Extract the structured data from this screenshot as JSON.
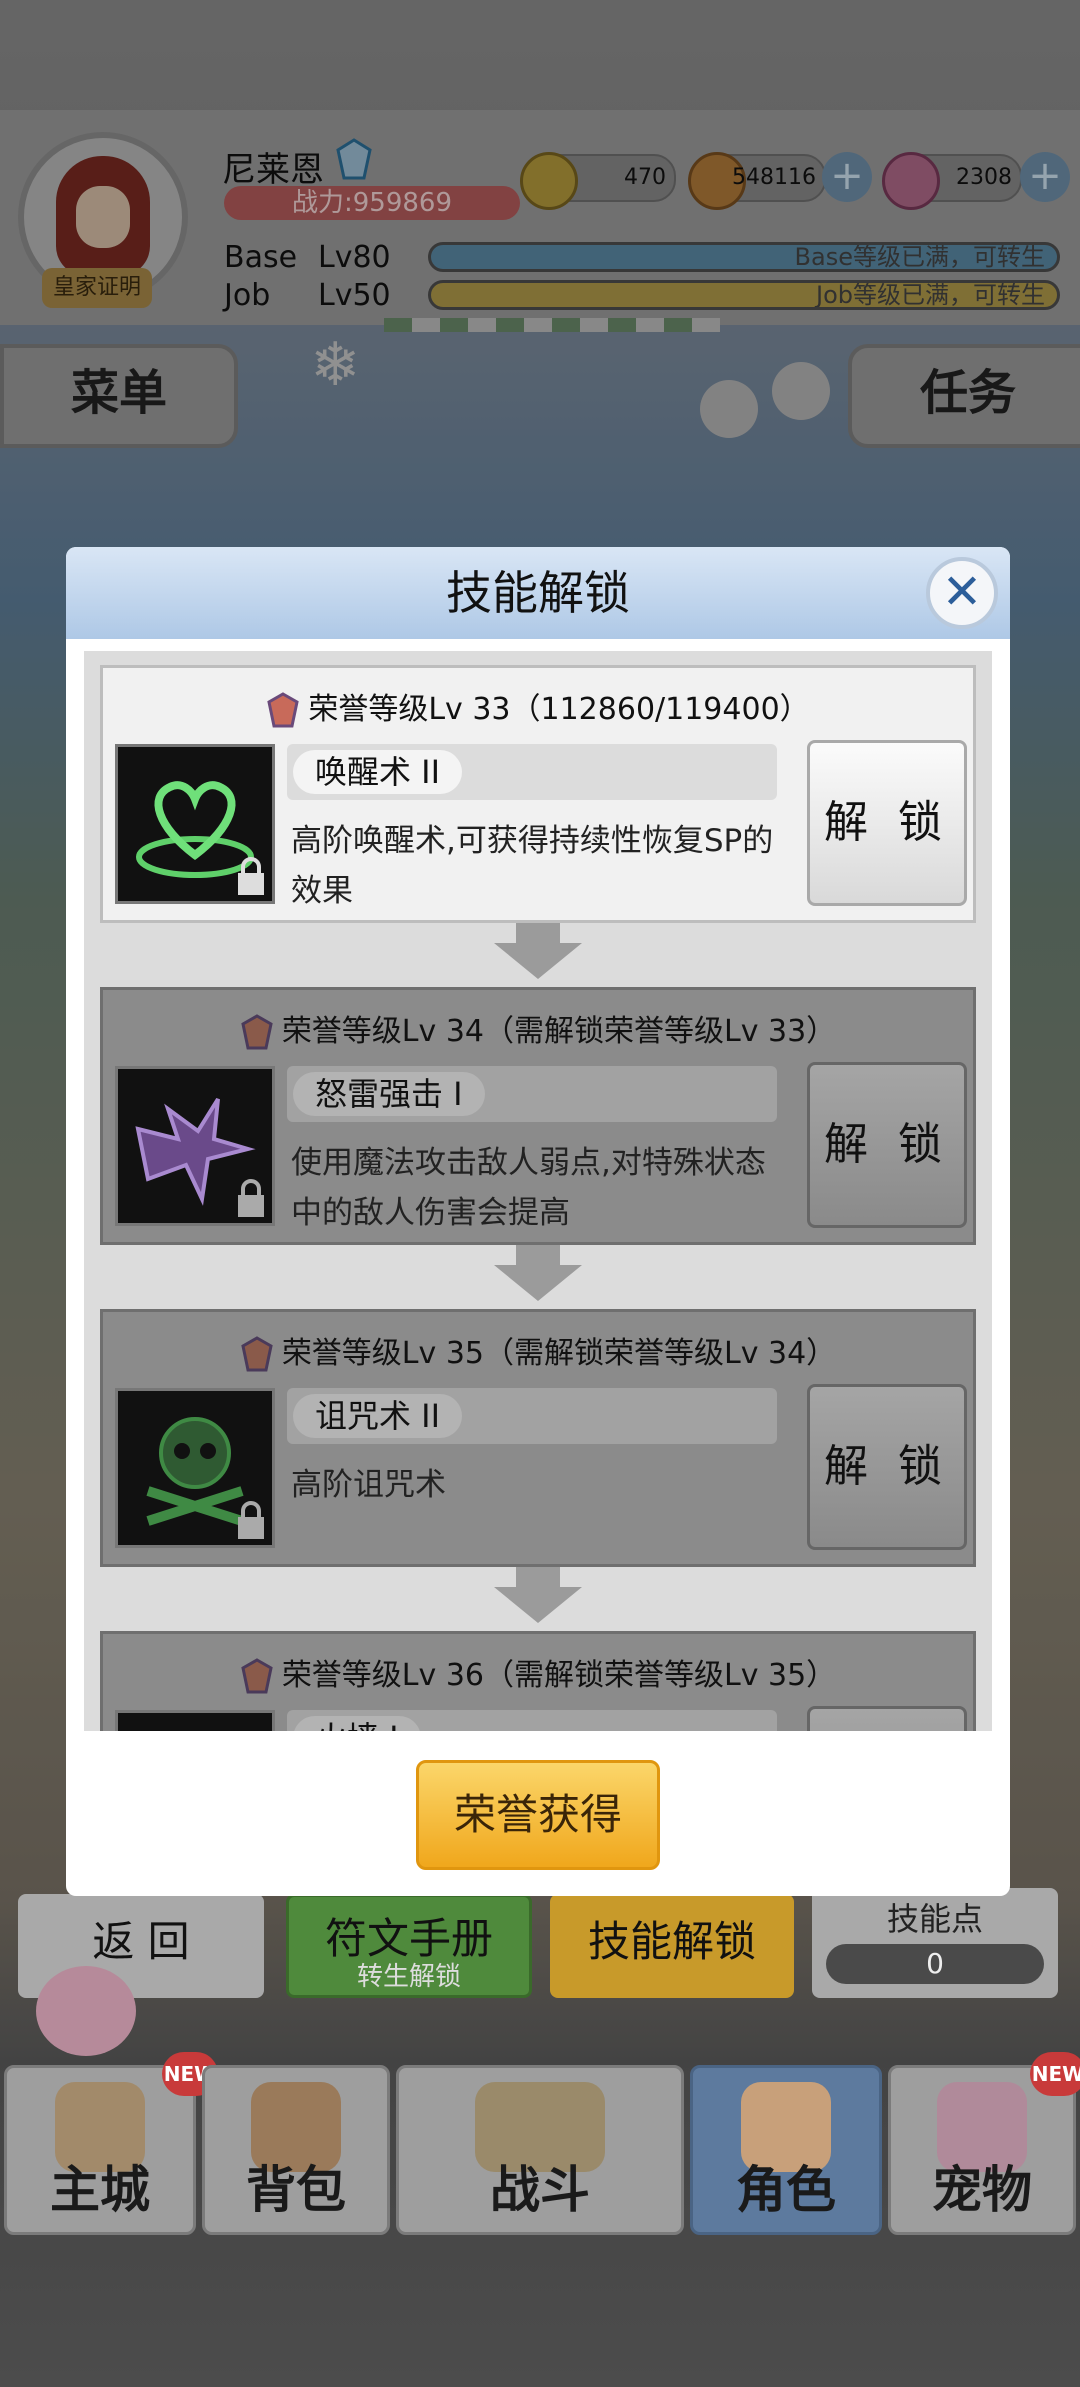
{
  "player": {
    "name": "尼莱恩",
    "badge": "皇家证明",
    "power": "战力:959869",
    "base_label": "Base",
    "base_level": "Lv80",
    "base_status": "Base等级已满，可转生",
    "job_label": "Job",
    "job_level": "Lv50",
    "job_status": "Job等级已满，可转生"
  },
  "currencies": [
    {
      "icon": "zeny-coin-icon",
      "value": "470"
    },
    {
      "icon": "gold-pot-icon",
      "value": "548116"
    },
    {
      "icon": "gem-icon",
      "value": "2308"
    }
  ],
  "top_buttons": {
    "menu": "菜单",
    "quests": "任务"
  },
  "modal": {
    "title": "技能解锁",
    "unlock_label": "解 锁",
    "honor_button": "荣誉获得",
    "skills": [
      {
        "header": "荣誉等级Lv 33（112860/119400）",
        "name": "唤醒术 II",
        "desc": "高阶唤醒术,可获得持续性恢复SP的效果",
        "state": "active"
      },
      {
        "header": "荣誉等级Lv 34（需解锁荣誉等级Lv 33）",
        "name": "怒雷强击 I",
        "desc": "使用魔法攻击敌人弱点,对特殊状态中的敌人伤害会提高",
        "state": "locked"
      },
      {
        "header": "荣誉等级Lv 35（需解锁荣誉等级Lv 34）",
        "name": "诅咒术 II",
        "desc": "高阶诅咒术",
        "state": "locked"
      },
      {
        "header": "荣誉等级Lv 36（需解锁荣誉等级Lv 35）",
        "name": "火墙 I",
        "desc": "",
        "state": "locked"
      }
    ]
  },
  "panel_buttons": {
    "back": "返 回",
    "rune_manual": "符文手册",
    "rune_sub": "转生解锁",
    "skill_unlock": "技能解锁",
    "skill_points_label": "技能点",
    "skill_points_value": "0"
  },
  "bottom_nav": [
    {
      "label": "主城",
      "new": "NEW"
    },
    {
      "label": "背包",
      "new": ""
    },
    {
      "label": "战斗",
      "new": ""
    },
    {
      "label": "角色",
      "new": ""
    },
    {
      "label": "宠物",
      "new": "NEW"
    }
  ],
  "colors": {
    "accent_gold": "#f0a71c",
    "modal_header": "#aec8e6",
    "power_bar": "#b45c5c"
  }
}
